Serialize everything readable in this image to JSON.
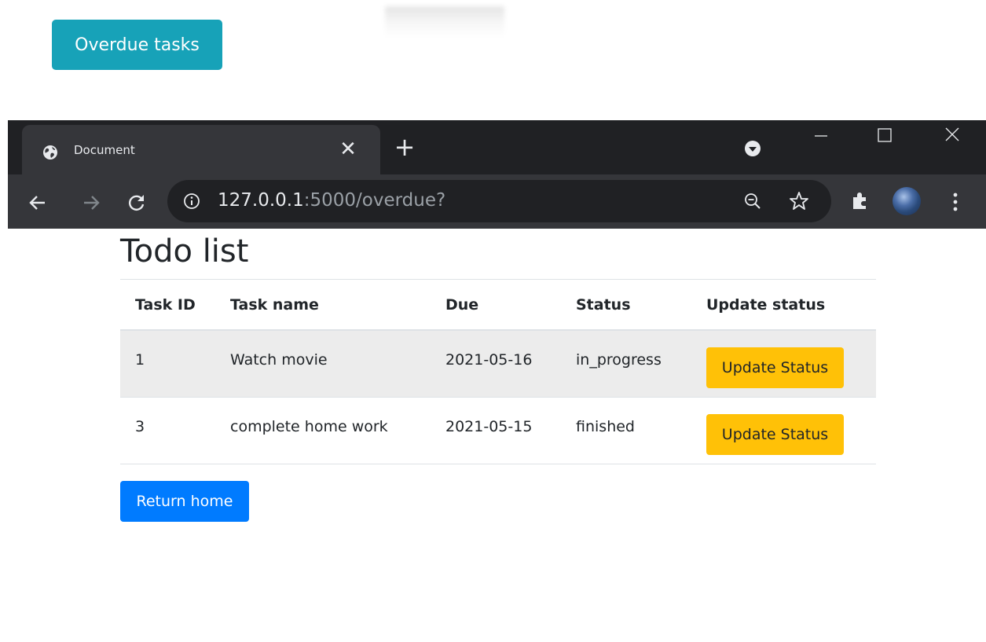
{
  "top": {
    "overdue_button_label": "Overdue tasks"
  },
  "browser": {
    "tab_title": "Document",
    "url_host": "127.0.0.1",
    "url_rest": ":5000/overdue?"
  },
  "page": {
    "title": "Todo list",
    "columns": [
      "Task ID",
      "Task name",
      "Due",
      "Status",
      "Update status"
    ],
    "rows": [
      {
        "id": "1",
        "name": "Watch movie",
        "due": "2021-05-16",
        "status": "in_progress",
        "action": "Update Status"
      },
      {
        "id": "3",
        "name": "complete home work",
        "due": "2021-05-15",
        "status": "finished",
        "action": "Update Status"
      }
    ],
    "return_label": "Return home"
  },
  "colors": {
    "overdue_button": "#17a2b8",
    "update_button": "#ffc107",
    "return_button": "#007bff",
    "chrome_dark": "#202124",
    "chrome_toolbar": "#35363a"
  },
  "icons": [
    "globe-icon",
    "close-icon",
    "plus-icon",
    "tab-search-icon",
    "minimize-icon",
    "maximize-icon",
    "window-close-icon",
    "back-icon",
    "forward-icon",
    "reload-icon",
    "info-icon",
    "zoom-out-icon",
    "star-icon",
    "extensions-icon",
    "avatar",
    "menu-icon"
  ]
}
